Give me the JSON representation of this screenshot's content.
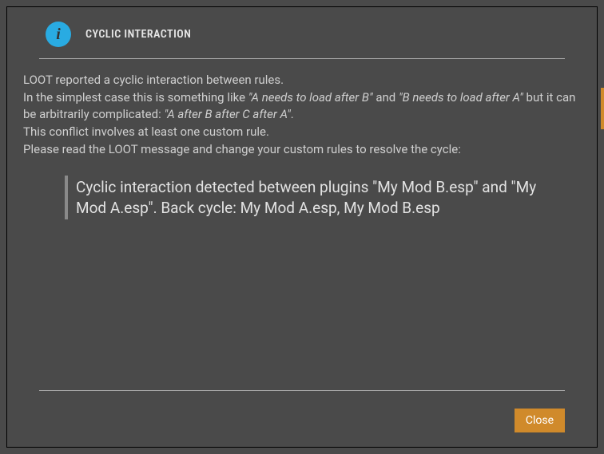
{
  "dialog": {
    "title": "CYCLIC INTERACTION",
    "icon_glyph": "i",
    "close_label": "Close"
  },
  "body": {
    "line1": "LOOT reported a cyclic interaction between rules.",
    "line2_a": "In the simplest case this is something like ",
    "line2_em1": "\"A needs to load after B\"",
    "line2_b": " and ",
    "line2_em2": "\"B needs to load after A\"",
    "line2_c": " but it can be arbitrarily complicated: ",
    "line2_em3": "\"A after B after C after A\"",
    "line2_d": ".",
    "line3": "This conflict involves at least one custom rule.",
    "line4": "Please read the LOOT message and change your custom rules to resolve the cycle:",
    "quote": "Cyclic interaction detected between plugins \"My Mod B.esp\" and \"My Mod A.esp\". Back cycle: My Mod A.esp, My Mod B.esp"
  },
  "colors": {
    "accent": "#d08a2b",
    "info_icon": "#29abe2"
  }
}
